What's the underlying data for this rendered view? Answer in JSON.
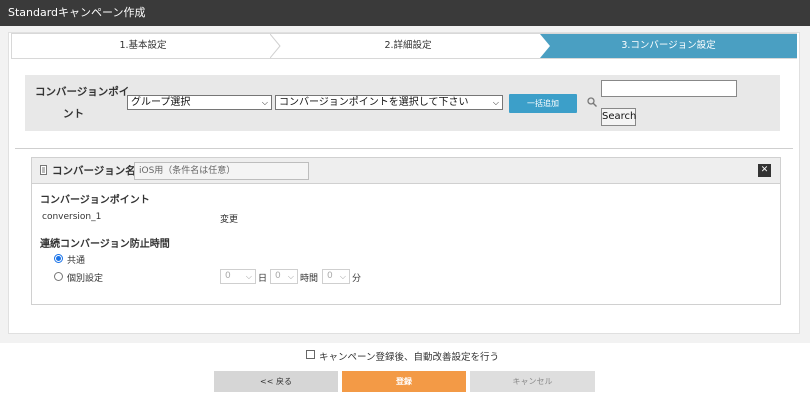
{
  "title": "Standardキャンペーン作成",
  "steps": [
    {
      "label": "1.基本設定"
    },
    {
      "label": "2.詳細設定"
    },
    {
      "label": "3.コンバージョン設定"
    }
  ],
  "cp_select": {
    "label_line1": "コンバージョンポイ",
    "label_line2": "ント",
    "group_select": "グループ選択",
    "point_select": "コンバージョンポイントを選択して下さい",
    "bulk_add": "一括追加",
    "search_value": "",
    "search_button": "Search"
  },
  "card": {
    "title": "コンバージョン名",
    "name_value": "iOS用（条件名は任意）",
    "close": "✕",
    "section_cp": "コンバージョンポイント",
    "cp_name": "conversion_1",
    "cp_change": "変更",
    "section_prevent": "連続コンバージョン防止時間",
    "radio_common": "共通",
    "radio_individual": "個別設定",
    "days_value": "0",
    "days_unit": "日",
    "hours_value": "0",
    "hours_unit": "時間",
    "minutes_value": "0",
    "minutes_unit": "分"
  },
  "auto_improve_label": "キャンペーン登録後、自動改善設定を行う",
  "buttons": {
    "back": "<< 戻る",
    "register": "登録",
    "cancel": "キャンセル"
  },
  "colors": {
    "active_step": "#4a9fc2",
    "bulk_add": "#3c9fc9",
    "register": "#f39a46",
    "titlebar": "#3a3a3a"
  }
}
